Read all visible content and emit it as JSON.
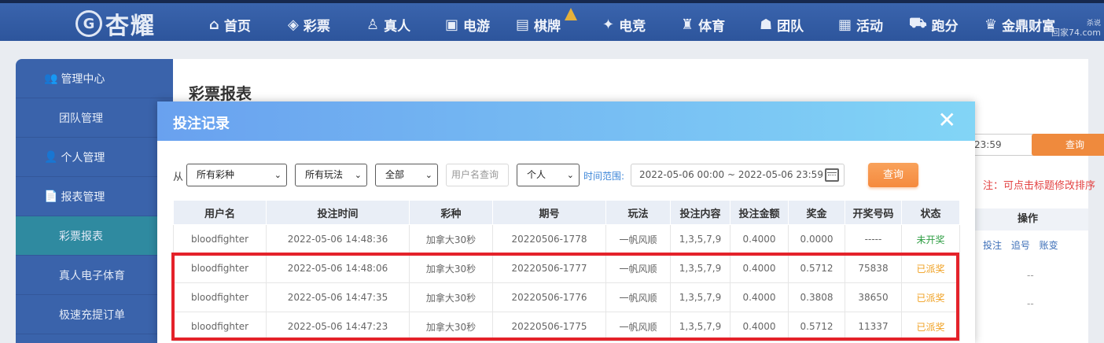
{
  "nav": {
    "logo_text": "杏耀",
    "logo_mark": "G",
    "items": [
      {
        "label": "首页",
        "icon": "⌂"
      },
      {
        "label": "彩票",
        "icon": "◈"
      },
      {
        "label": "真人",
        "icon": "♙"
      },
      {
        "label": "电游",
        "icon": "▣"
      },
      {
        "label": "棋牌",
        "icon": "▤"
      },
      {
        "label": "电竞",
        "icon": "✦"
      },
      {
        "label": "体育",
        "icon": "♜"
      },
      {
        "label": "团队",
        "icon": "☗"
      },
      {
        "label": "活动",
        "icon": "▦"
      },
      {
        "label": "跑分",
        "icon": "⛟"
      },
      {
        "label": "金鼎财富",
        "icon": "♛"
      }
    ],
    "watermark_top": "杀说",
    "watermark_site": "回家74.com"
  },
  "sidebar": {
    "management_center": "管理中心",
    "team_management": "团队管理",
    "personal_management": "个人管理",
    "report_management": "报表管理",
    "lottery_report": "彩票报表",
    "live_sports": "真人电子体育",
    "fast_deposit": "极速充提订单"
  },
  "page": {
    "title": "彩票报表",
    "date_fragment": "23:59",
    "query": "查询",
    "note": "注：可点击标题修改排序",
    "ops_header": "操作",
    "ops": "投注 追号 账变",
    "dash": "--"
  },
  "modal": {
    "title": "投注记录",
    "close": "✕",
    "from_label": "从",
    "lottery_select": "所有彩种",
    "play_select": "所有玩法",
    "status_select": "全部",
    "username_placeholder": "用户名查询",
    "scope_select": "个人",
    "time_range_label": "时间范围:",
    "time_range_value": "2022-05-06 00:00 ~ 2022-05-06 23:59",
    "query_button": "查询",
    "columns": [
      "用户名",
      "投注时间",
      "彩种",
      "期号",
      "玩法",
      "投注内容",
      "投注金额",
      "奖金",
      "开奖号码",
      "状态"
    ],
    "rows": [
      {
        "user": "bloodfighter",
        "time": "2022-05-06 14:48:36",
        "lottery": "加拿大30秒",
        "issue": "20220506-1778",
        "play": "一帆风顺",
        "content": "1,3,5,7,9",
        "amount": "0.4000",
        "prize": "0.0000",
        "draw": "-----",
        "status": "未开奖",
        "status_kind": "pending"
      },
      {
        "user": "bloodfighter",
        "time": "2022-05-06 14:48:06",
        "lottery": "加拿大30秒",
        "issue": "20220506-1777",
        "play": "一帆风顺",
        "content": "1,3,5,7,9",
        "amount": "0.4000",
        "prize": "0.5712",
        "draw": "75838",
        "status": "已派奖",
        "status_kind": "paid"
      },
      {
        "user": "bloodfighter",
        "time": "2022-05-06 14:47:35",
        "lottery": "加拿大30秒",
        "issue": "20220506-1776",
        "play": "一帆风顺",
        "content": "1,3,5,7,9",
        "amount": "0.4000",
        "prize": "0.3808",
        "draw": "38650",
        "status": "已派奖",
        "status_kind": "paid"
      },
      {
        "user": "bloodfighter",
        "time": "2022-05-06 14:47:23",
        "lottery": "加拿大30秒",
        "issue": "20220506-1775",
        "play": "一帆风顺",
        "content": "1,3,5,7,9",
        "amount": "0.4000",
        "prize": "0.5712",
        "draw": "11337",
        "status": "已派奖",
        "status_kind": "paid"
      }
    ]
  }
}
